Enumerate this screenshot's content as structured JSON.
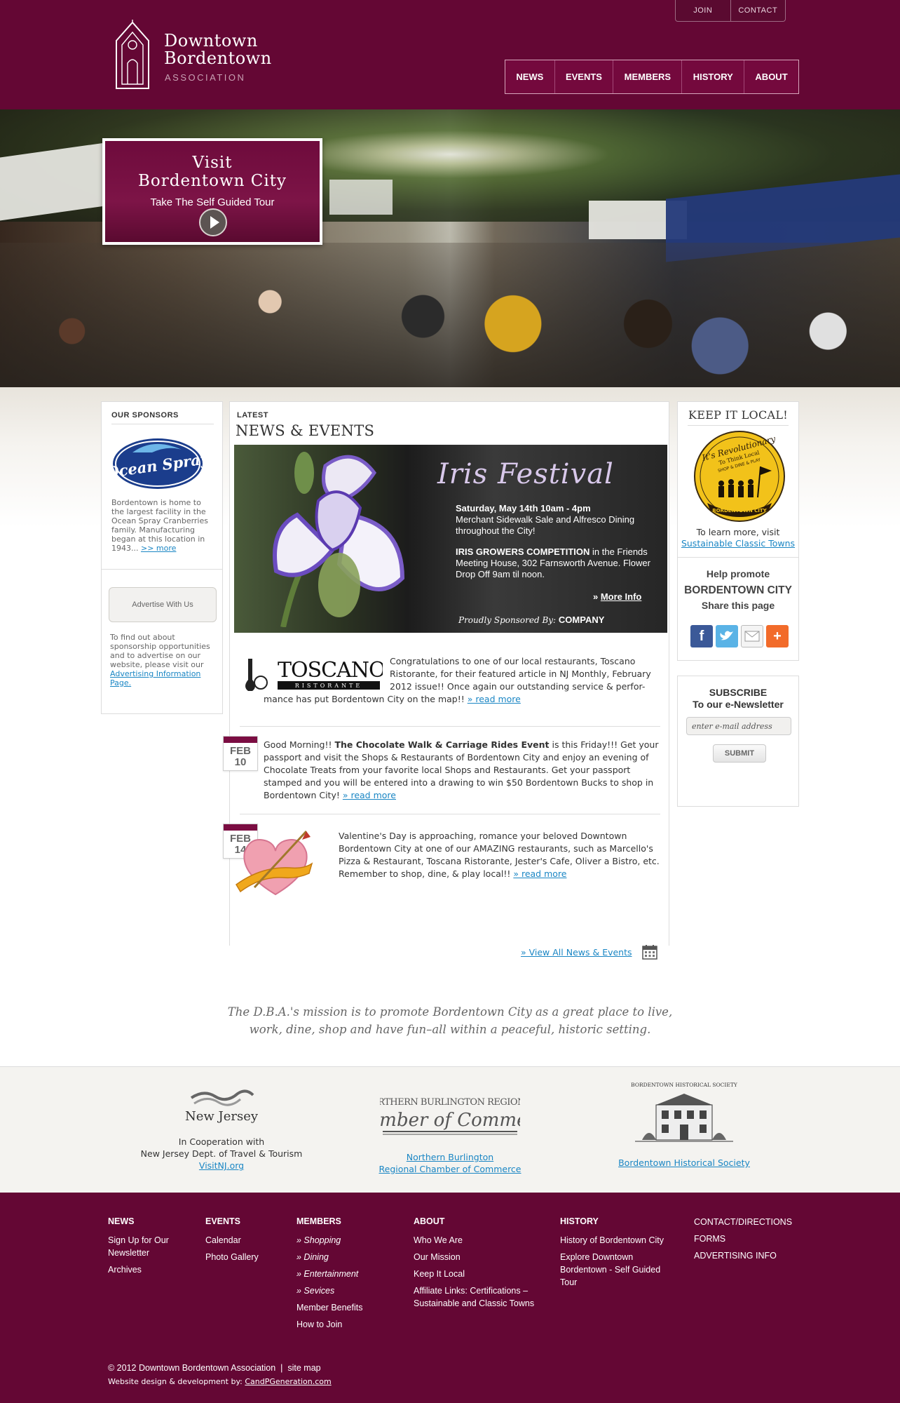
{
  "header": {
    "logo_line1": "Downtown",
    "logo_line2": "Bordentown",
    "logo_line3": "ASSOCIATION",
    "util": [
      "JOIN",
      "CONTACT"
    ],
    "nav": [
      "NEWS",
      "EVENTS",
      "MEMBERS",
      "HISTORY",
      "ABOUT"
    ]
  },
  "hero": {
    "title1": "Visit",
    "title2": "Bordentown City",
    "subtitle": "Take The Self Guided Tour"
  },
  "sponsors": {
    "heading": "OUR SPONSORS",
    "logo_text": "Ocean Spray",
    "text": "Bordentown is home to the largest facility in the Ocean Spray Cranberries family. Manufacturing began at this location in 1943...",
    "more": ">> more",
    "advertise_button": "Advertise With Us",
    "advertise_text": "To find out about sponsorship opportunities and to advertise on our website, please visit our",
    "advertise_link": "Advertising Information Page."
  },
  "news": {
    "latest": "LATEST",
    "heading": "NEWS & EVENTS",
    "feature": {
      "title": "Iris Festival",
      "datetime": "Saturday, May 14th 10am - 4pm",
      "desc1": "Merchant Sidewalk Sale and Alfresco Dining throughout the City!",
      "desc2_bold": "IRIS GROWERS COMPETITION",
      "desc2": " in the Friends Meeting House, 302 Farnsworth Avenue. Flower Drop Off 9am til noon.",
      "more_prefix": "» ",
      "more": "More Info",
      "sponsored_by": "Proudly Sponsored By:",
      "company": "COMPANY"
    },
    "toscano": {
      "logo_name": "TOSCANO",
      "logo_sub": "RISTORANTE",
      "text_a": "Congratulations to one of our local restaurants, Toscano Ristorante, for their featured article in NJ Monthly, February 2012 issue!! Once again our outstanding service & perfor-",
      "text_b": "mance has put Bordentown City on the map!!",
      "read_more": "» read more"
    },
    "items": [
      {
        "month": "FEB",
        "day": "10",
        "intro": "Good Morning!! ",
        "bold": "The Chocolate Walk & Carriage Rides Event",
        "text": " is this Friday!!! Get your passport and visit the Shops & Restaurants of Bordentown City and enjoy an evening of Chocolate Treats from your favorite local Shops and Restaurants. Get your passport stamped and you will be entered into a drawing to win $50 Bordentown Bucks to shop in Bordentown City! ",
        "read_more": "» read more"
      },
      {
        "month": "FEB",
        "day": "14",
        "text": "Valentine's Day is approaching, romance your beloved Downtown Bordentown City at one of our AMAZING restaurants, such as Marcello's Pizza & Restaurant, Toscana Ristorante, Jester's Cafe, Oliver a Bistro, etc. Remember to shop, dine, & play local!! ",
        "read_more": "» read more"
      }
    ],
    "view_all": "» View All News & Events"
  },
  "keep_local": {
    "heading": "KEEP IT LOCAL!",
    "badge_line1": "It's Revolutionary",
    "badge_line2": "To Think Local",
    "badge_line3": "SHOP & DINE & PLAY",
    "badge_bottom": "BORDENTOWN CITY",
    "learn": "To learn more, visit",
    "learn_link": "Sustainable Classic Towns",
    "help1": "Help promote",
    "help2": "BORDENTOWN CITY",
    "help3": "Share this page"
  },
  "subscribe": {
    "line1": "SUBSCRIBE",
    "line2": "To our e-Newsletter",
    "placeholder": "enter e-mail address",
    "button": "SUBMIT"
  },
  "mission": {
    "line1": "The D.B.A.'s mission is to promote Bordentown City as a great place to live,",
    "line2": "work, dine, shop and have fun–all within a peaceful, historic setting."
  },
  "partners": {
    "nj_logo": "New Jersey",
    "nj_line1": "In Cooperation with",
    "nj_line2": "New Jersey Dept. of Travel & Tourism",
    "nj_link": "VisitNJ.org",
    "chamber_logo1": "NORTHERN BURLINGTON REGIONAL",
    "chamber_logo2": "Chamber of Commerce",
    "chamber_link1": "Northern Burlington",
    "chamber_link2": "Regional Chamber of Commerce",
    "hist_logo": "BORDENTOWN HISTORICAL SOCIETY",
    "hist_link": "Bordentown Historical Society"
  },
  "footer": {
    "news": {
      "heading": "NEWS",
      "links": [
        "Sign Up for Our Newsletter",
        "Archives"
      ]
    },
    "events": {
      "heading": "EVENTS",
      "links": [
        "Calendar",
        "Photo Gallery"
      ]
    },
    "members": {
      "heading": "MEMBERS",
      "links": [
        "» Shopping",
        "» Dining",
        "» Entertainment",
        "» Sevices",
        "Member Benefits",
        "How to Join"
      ]
    },
    "about": {
      "heading": "ABOUT",
      "links": [
        "Who We Are",
        "Our Mission",
        "Keep It Local",
        "Affiliate Links: Certifications – Sustainable and Classic Towns"
      ]
    },
    "history": {
      "heading": "HISTORY",
      "links": [
        "History of Bordentown City",
        "Explore Downtown Bordentown - Self Guided Tour"
      ]
    },
    "contact": {
      "links": [
        "CONTACT/DIRECTIONS",
        "FORMS",
        "ADVERTISING INFO"
      ]
    },
    "copyright": "© 2012 Downtown Bordentown Association",
    "sep": "|",
    "sitemap": "site map",
    "credit": "Website design & development by:",
    "credit_link": "CandPGeneration.com"
  },
  "colors": {
    "brand": "#640734",
    "link": "#1a86c4",
    "badge_yellow": "#f2c21a"
  }
}
